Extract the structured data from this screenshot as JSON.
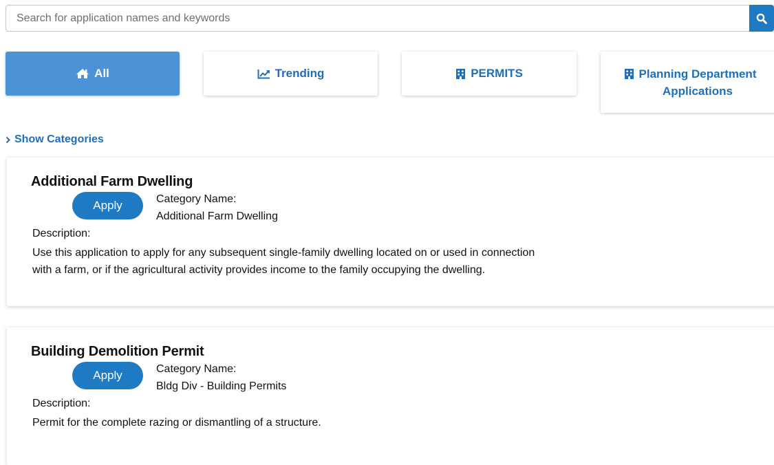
{
  "search": {
    "placeholder": "Search for application names and keywords",
    "value": "",
    "button_icon": "search-icon"
  },
  "tabs": [
    {
      "label": "All",
      "icon": "home-icon",
      "active": true
    },
    {
      "label": "Trending",
      "icon": "line-chart-icon",
      "active": false
    },
    {
      "label": "PERMITS",
      "icon": "building-icon",
      "active": false
    },
    {
      "label": "Planning Department Applications",
      "label_line1": "Planning Department",
      "label_line2": "Applications",
      "icon": "building-icon",
      "active": false
    }
  ],
  "show_categories": {
    "label": "Show Categories",
    "icon": "chevron-right-icon"
  },
  "applications": [
    {
      "title": "Additional Farm Dwelling",
      "apply_label": "Apply",
      "category_label": "Category Name:",
      "category_value": "Additional Farm Dwelling",
      "description_label": "Description:",
      "description": "Use this application to apply for any subsequent single-family dwelling located on or used in connection with a farm, or if the agricultural activity provides income to the family occupying the dwelling."
    },
    {
      "title": "Building Demolition Permit",
      "apply_label": "Apply",
      "category_label": "Category Name:",
      "category_value": "Bldg Div - Building Permits",
      "description_label": "Description:",
      "description": "Permit for the complete razing or dismantling of a structure."
    }
  ],
  "colors": {
    "primary": "#1f7ac4",
    "active_tab": "#4b92d6",
    "link": "#1f6fb8"
  }
}
